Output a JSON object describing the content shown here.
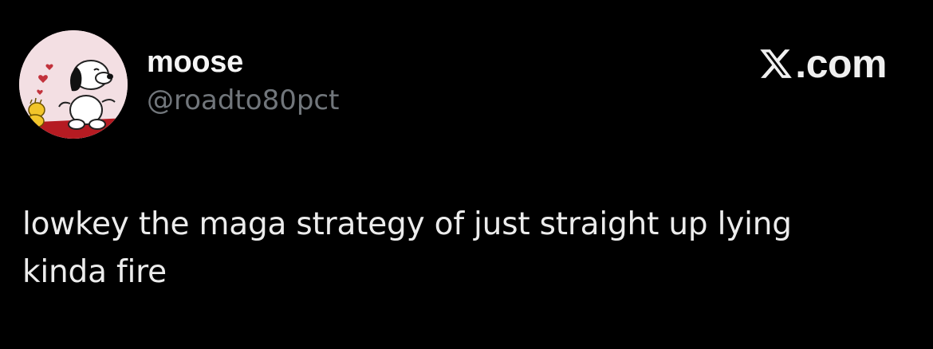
{
  "author": {
    "display_name": "moose",
    "handle": "@roadto80pct",
    "avatar_icon": "snoopy-woodstock-avatar-icon"
  },
  "brand": {
    "icon": "x-logo-icon",
    "text": ".com"
  },
  "tweet": {
    "text": "lowkey the maga strategy of just straight up lying\nkinda fire"
  },
  "colors": {
    "background": "#000000",
    "primary_text": "#e7e9ea",
    "secondary_text": "#71767b",
    "avatar_background": "#f3dfe3"
  }
}
